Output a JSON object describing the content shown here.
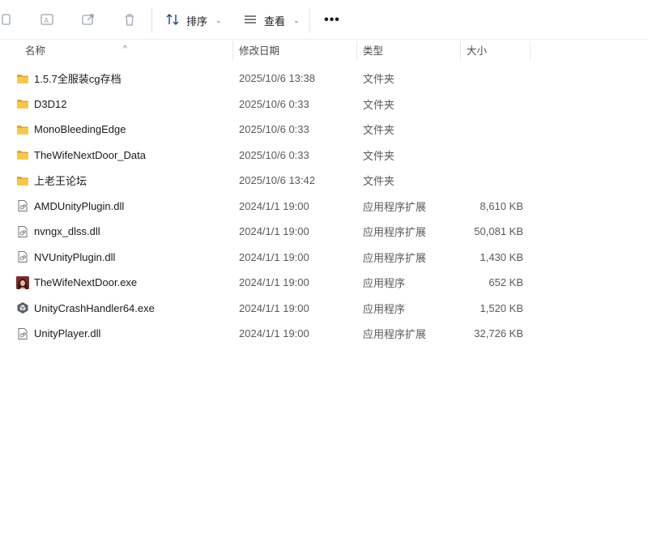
{
  "toolbar": {
    "sort_label": "排序",
    "view_label": "查看",
    "more_label": "•••"
  },
  "columns": {
    "name": "名称",
    "date": "修改日期",
    "type": "类型",
    "size": "大小"
  },
  "files": [
    {
      "name": "1.5.7全服装cg存档",
      "date": "2025/10/6 13:38",
      "type": "文件夹",
      "size": "",
      "icon": "folder-icon"
    },
    {
      "name": "D3D12",
      "date": "2025/10/6 0:33",
      "type": "文件夹",
      "size": "",
      "icon": "folder-icon"
    },
    {
      "name": "MonoBleedingEdge",
      "date": "2025/10/6 0:33",
      "type": "文件夹",
      "size": "",
      "icon": "folder-icon"
    },
    {
      "name": "TheWifeNextDoor_Data",
      "date": "2025/10/6 0:33",
      "type": "文件夹",
      "size": "",
      "icon": "folder-icon"
    },
    {
      "name": "上老王论坛",
      "date": "2025/10/6 13:42",
      "type": "文件夹",
      "size": "",
      "icon": "folder-icon"
    },
    {
      "name": "AMDUnityPlugin.dll",
      "date": "2024/1/1 19:00",
      "type": "应用程序扩展",
      "size": "8,610 KB",
      "icon": "dll-file-icon"
    },
    {
      "name": "nvngx_dlss.dll",
      "date": "2024/1/1 19:00",
      "type": "应用程序扩展",
      "size": "50,081 KB",
      "icon": "dll-file-icon"
    },
    {
      "name": "NVUnityPlugin.dll",
      "date": "2024/1/1 19:00",
      "type": "应用程序扩展",
      "size": "1,430 KB",
      "icon": "dll-file-icon"
    },
    {
      "name": "TheWifeNextDoor.exe",
      "date": "2024/1/1 19:00",
      "type": "应用程序",
      "size": "652 KB",
      "icon": "app-portrait-icon"
    },
    {
      "name": "UnityCrashHandler64.exe",
      "date": "2024/1/1 19:00",
      "type": "应用程序",
      "size": "1,520 KB",
      "icon": "unity-icon"
    },
    {
      "name": "UnityPlayer.dll",
      "date": "2024/1/1 19:00",
      "type": "应用程序扩展",
      "size": "32,726 KB",
      "icon": "dll-file-icon"
    }
  ],
  "colors": {
    "folder": "#F4C24C",
    "folder_dark": "#E0A82E",
    "toolbar_icon": "#9aa6b2"
  }
}
